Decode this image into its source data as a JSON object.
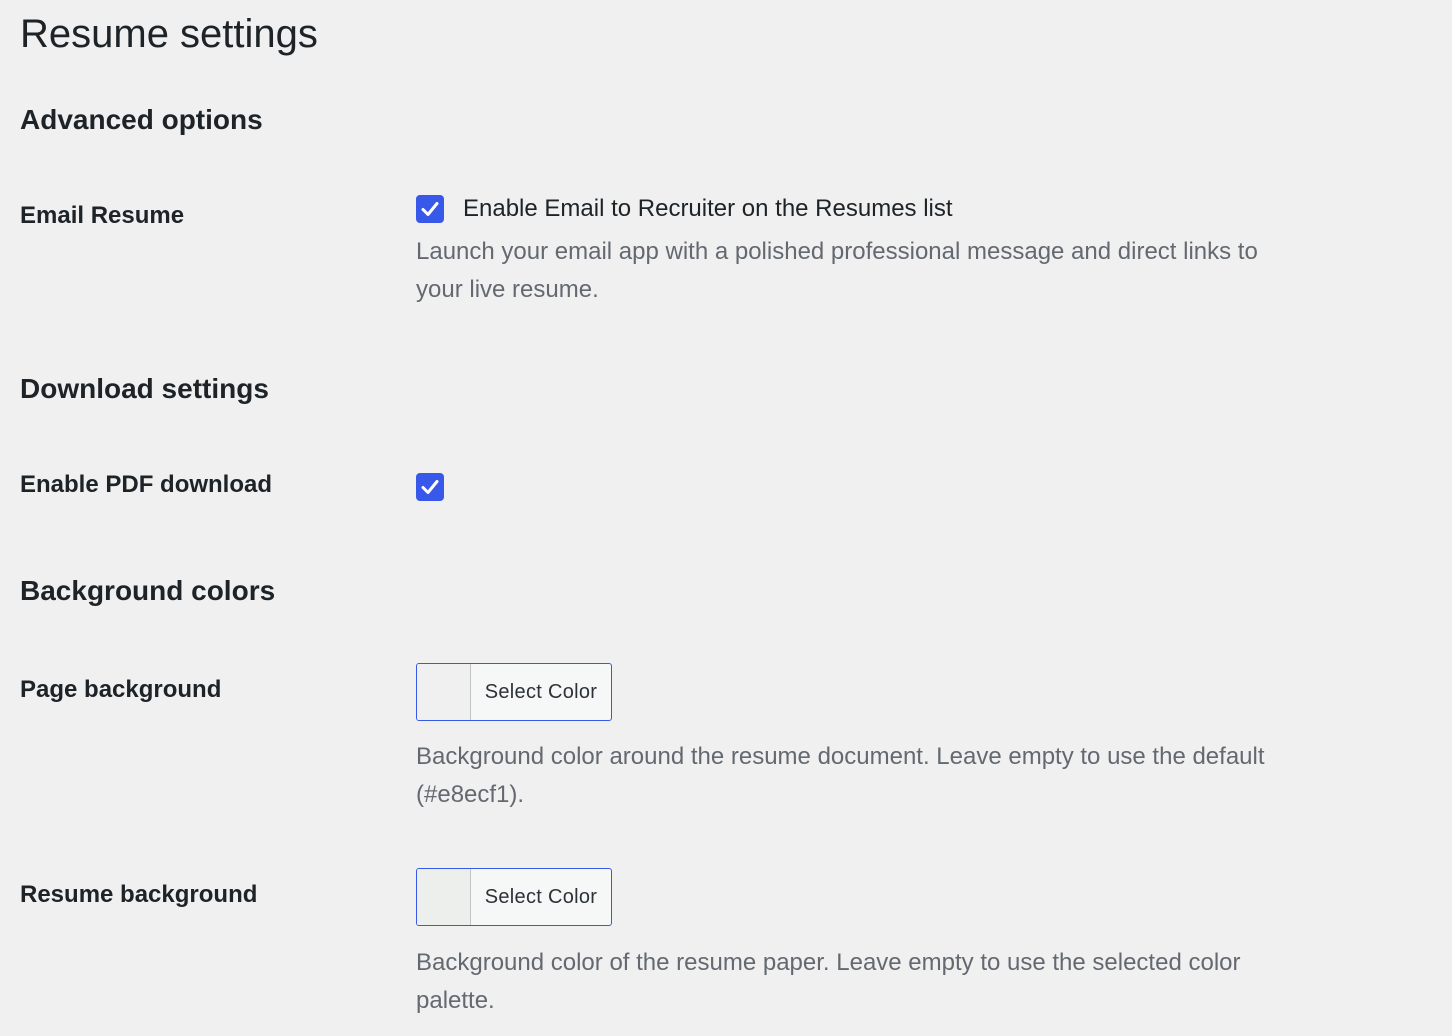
{
  "page": {
    "title": "Resume settings"
  },
  "advanced_options": {
    "heading": "Advanced options",
    "email_resume": {
      "label": "Email Resume",
      "checkbox_label": "Enable Email to Recruiter on the Resumes list",
      "checked": true,
      "description": "Launch your email app with a polished professional message and direct links to your live resume."
    }
  },
  "download_settings": {
    "heading": "Download settings",
    "pdf_download": {
      "label": "Enable PDF download",
      "checked": true
    }
  },
  "background_colors": {
    "heading": "Background colors",
    "page_background": {
      "label": "Page background",
      "button_label": "Select Color",
      "swatch_color": "#f0f0f1",
      "description": "Background color around the resume document. Leave empty to use the default (#e8ecf1)."
    },
    "resume_background": {
      "label": "Resume background",
      "button_label": "Select Color",
      "swatch_color": "#edefec",
      "description": "Background color of the resume paper. Leave empty to use the selected color palette."
    }
  },
  "colors": {
    "accent": "#3858e9",
    "page_bg": "#f0f0f1",
    "text": "#1d2327",
    "muted_text": "#646970"
  },
  "icons": {
    "checkmark": "checkmark-icon"
  }
}
